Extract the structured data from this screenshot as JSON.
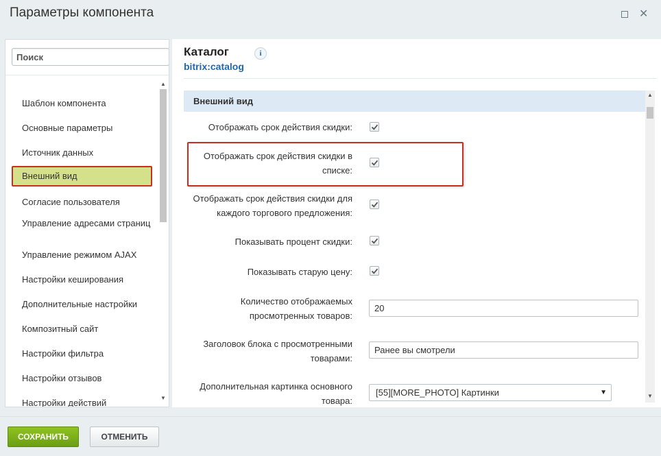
{
  "window": {
    "title": "Параметры компонента",
    "maximize_icon": "maximize-icon",
    "close_icon": "close-icon",
    "close_glyph": "✕"
  },
  "sidebar": {
    "search_placeholder": "Поиск",
    "items": [
      {
        "label": "Шаблон компонента"
      },
      {
        "label": "Основные параметры"
      },
      {
        "label": "Источник данных"
      },
      {
        "label": "Внешний вид",
        "active": true
      },
      {
        "label": "Согласие пользователя"
      },
      {
        "label": "Управление адресами страниц"
      },
      {
        "label": "Управление режимом AJAX"
      },
      {
        "label": "Настройки кеширования"
      },
      {
        "label": "Дополнительные настройки"
      },
      {
        "label": "Композитный сайт"
      },
      {
        "label": "Настройки фильтра"
      },
      {
        "label": "Настройки отзывов"
      },
      {
        "label": "Настройки действий"
      }
    ]
  },
  "component": {
    "name": "Каталог",
    "code": "bitrix:catalog",
    "info_icon_glyph": "i"
  },
  "section": {
    "title": "Внешний вид",
    "rows": [
      {
        "label": "Отображать срок действия скидки:",
        "type": "checkbox",
        "checked": true
      },
      {
        "label": "Отображать срок действия скидки в списке:",
        "type": "checkbox",
        "checked": true,
        "highlighted": true
      },
      {
        "label": "Отображать срок действия скидки для каждого торгового предложения:",
        "type": "checkbox",
        "checked": true
      },
      {
        "label": "Показывать процент скидки:",
        "type": "checkbox",
        "checked": true
      },
      {
        "label": "Показывать старую цену:",
        "type": "checkbox",
        "checked": true
      },
      {
        "label": "Количество отображаемых просмотренных товаров:",
        "type": "text",
        "value": "20"
      },
      {
        "label": "Заголовок блока с просмотренными товарами:",
        "type": "text",
        "value": "Ранее вы смотрели"
      },
      {
        "label": "Дополнительная картинка основного товара:",
        "type": "select",
        "value": "[55][MORE_PHOTO] Картинки"
      }
    ]
  },
  "footer": {
    "save_label": "СОХРАНИТЬ",
    "cancel_label": "ОТМЕНИТЬ"
  },
  "colors": {
    "accent_green": "#6b9e14",
    "active_item_bg": "#d4e08a",
    "highlight_red": "#c72f1e",
    "link_blue": "#2067b0",
    "section_bg": "#dde9f4"
  }
}
